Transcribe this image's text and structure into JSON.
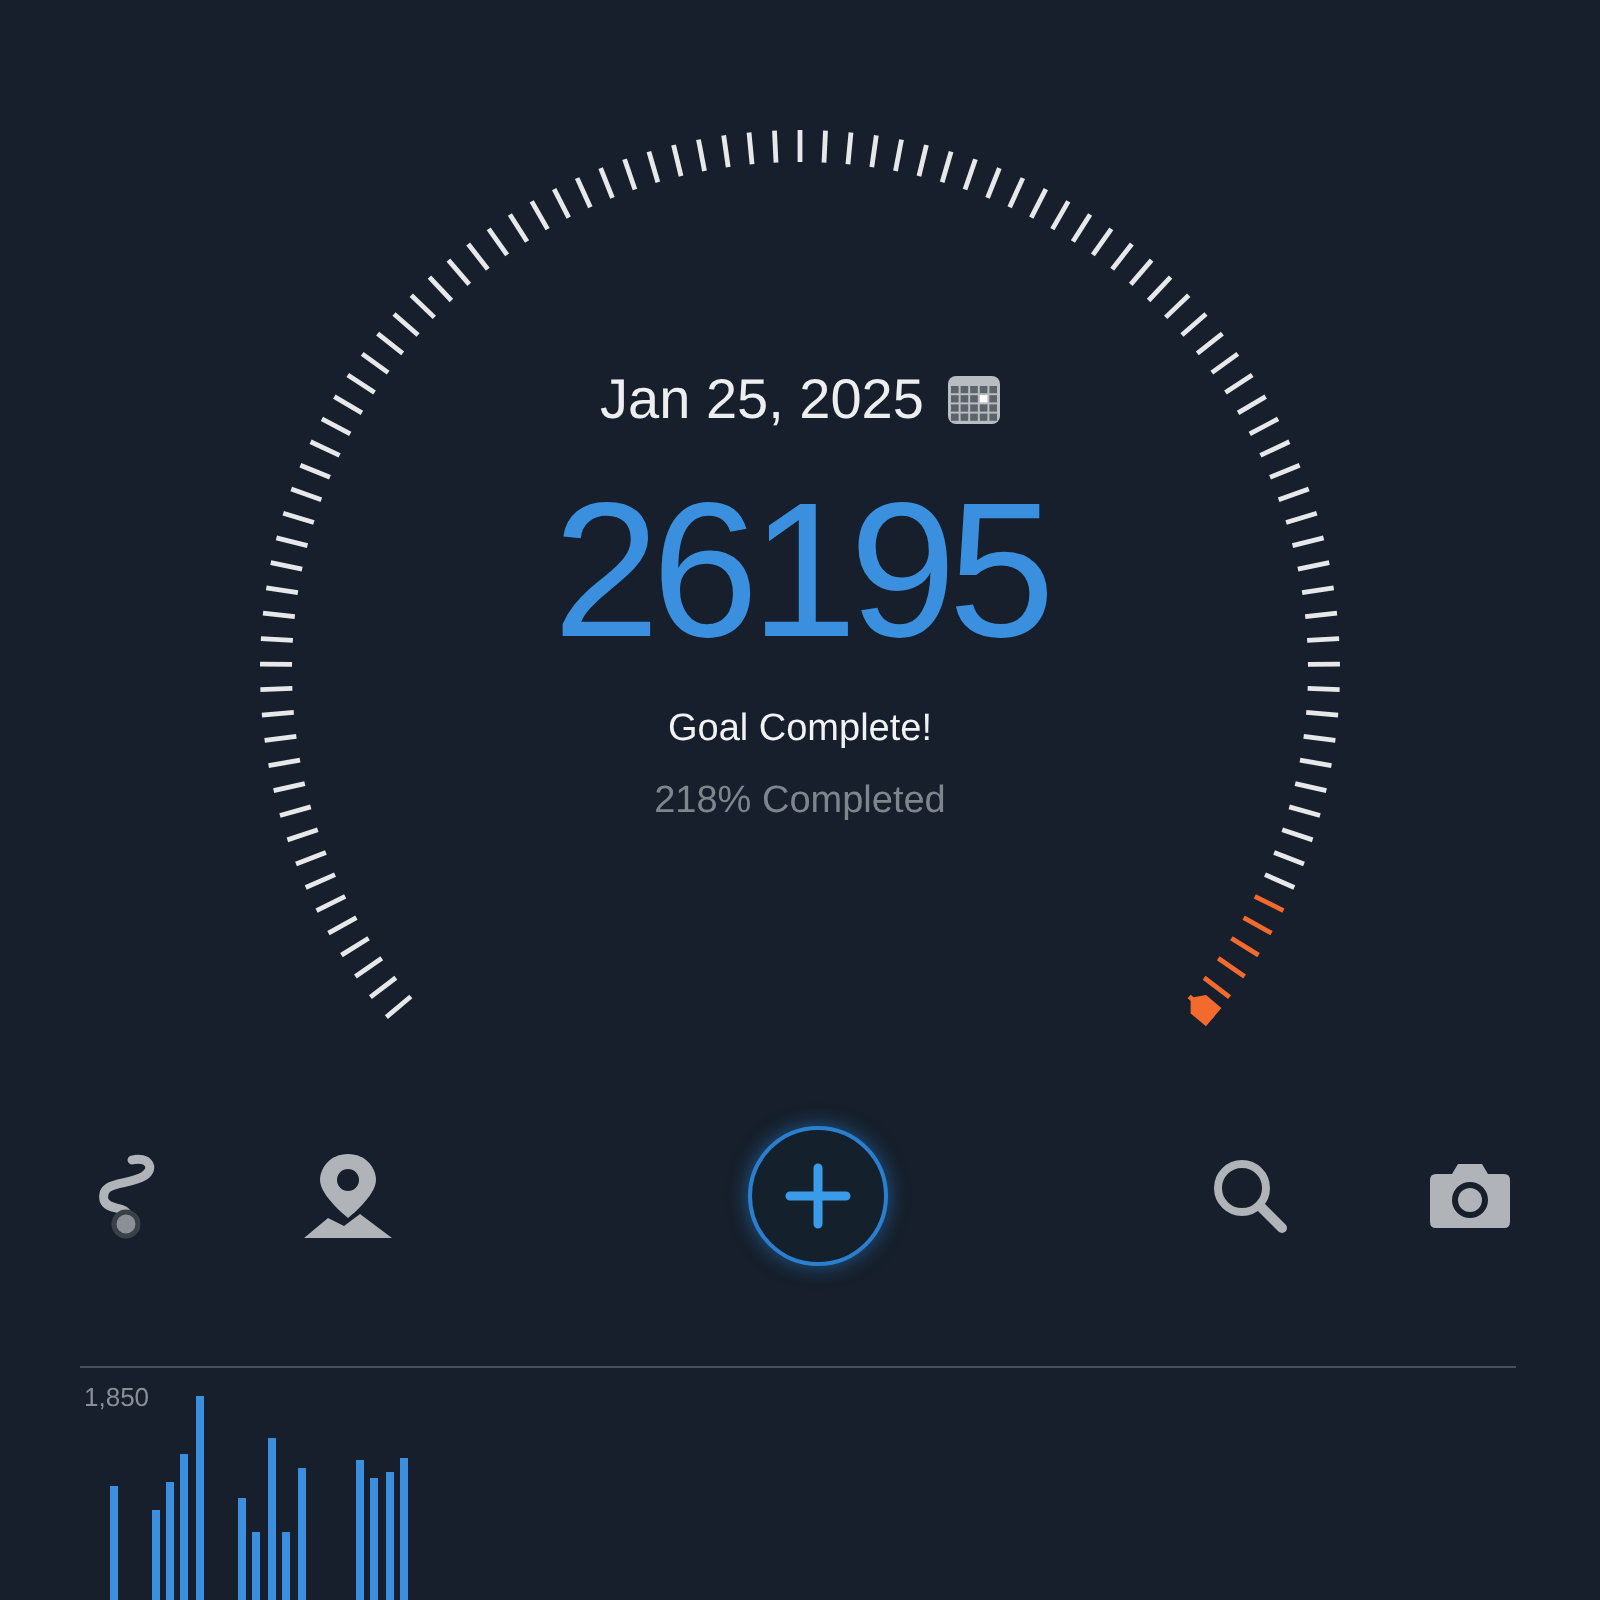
{
  "date": "Jan 25, 2025",
  "steps": "26195",
  "status": "Goal Complete!",
  "progress_text": "218% Completed",
  "chart": {
    "max_label": "1,850"
  }
}
